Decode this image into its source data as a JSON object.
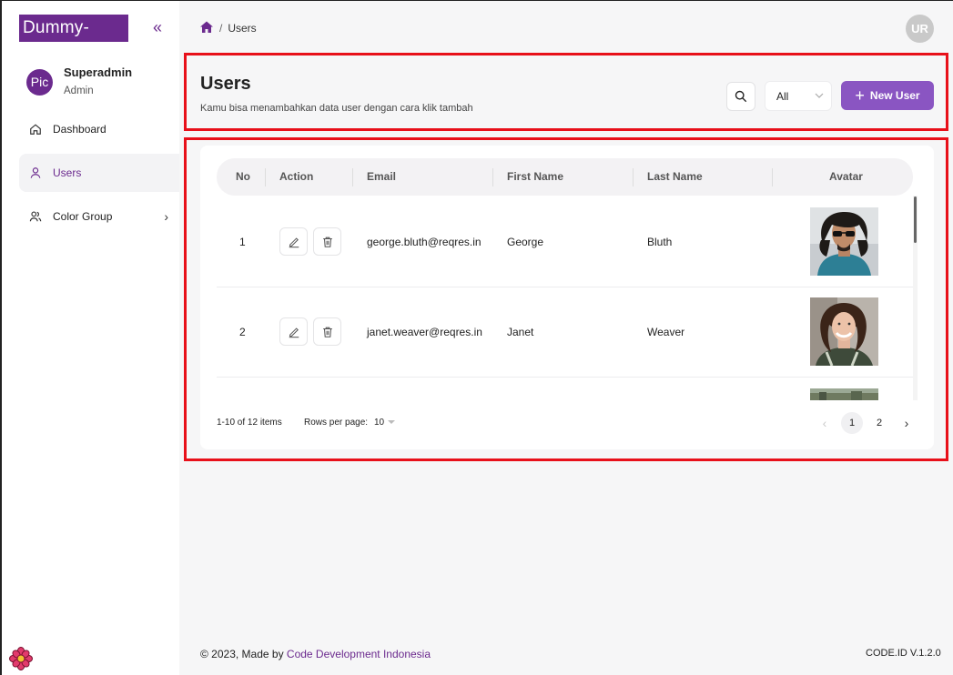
{
  "brand": {
    "logo_text": "Dummy-Logo",
    "accent": "#6b2a8e",
    "button_color": "#8a55c2",
    "highlight": "#e8101a"
  },
  "sidebar": {
    "collapse_icon": "double-chevron-left-icon",
    "profile": {
      "avatar_text": "Pic",
      "name": "Superadmin",
      "role": "Admin"
    },
    "items": [
      {
        "label": "Dashboard",
        "icon": "home-outline-icon",
        "active": false
      },
      {
        "label": "Users",
        "icon": "user-icon",
        "active": true
      },
      {
        "label": "Color Group",
        "icon": "users-group-icon",
        "active": false,
        "has_children": true
      }
    ]
  },
  "topbar": {
    "breadcrumb": {
      "separator": "/",
      "current": "Users"
    },
    "avatar_initials": "UR"
  },
  "header": {
    "title": "Users",
    "subtitle": "Kamu bisa menambahkan data user dengan cara klik tambah",
    "filter_value": "All",
    "new_button_label": "New User"
  },
  "table": {
    "columns": [
      "No",
      "Action",
      "Email",
      "First Name",
      "Last Name",
      "Avatar"
    ],
    "rows": [
      {
        "no": "1",
        "email": "george.bluth@reqres.in",
        "first_name": "George",
        "last_name": "Bluth"
      },
      {
        "no": "2",
        "email": "janet.weaver@reqres.in",
        "first_name": "Janet",
        "last_name": "Weaver"
      }
    ]
  },
  "pagination": {
    "range_text": "1-10 of 12 items",
    "rows_per_page_label": "Rows per page:",
    "rows_per_page_value": "10",
    "pages": [
      "1",
      "2"
    ],
    "current_page": "1"
  },
  "footer": {
    "copyright_prefix": "© 2023, Made by ",
    "company": "Code Development Indonesia",
    "version": "CODE.ID V.1.2.0"
  }
}
